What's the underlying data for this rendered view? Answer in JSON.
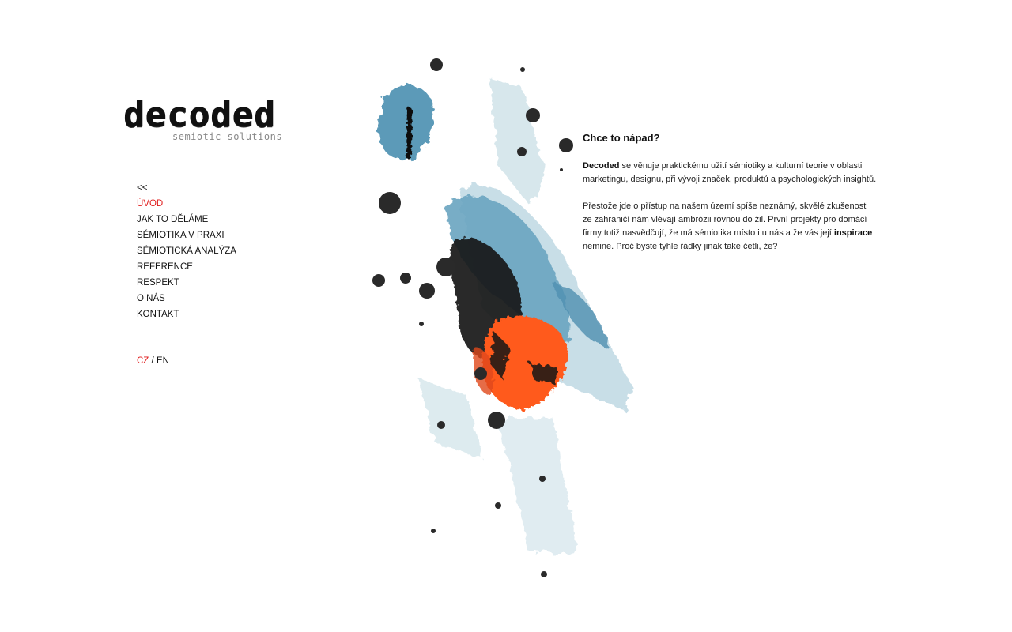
{
  "logo": {
    "main": "decoded",
    "sub": "semiotic solutions"
  },
  "nav": {
    "back": "<<",
    "items": [
      {
        "label": "ÚVOD",
        "active": true
      },
      {
        "label": "JAK TO DĚLÁME",
        "active": false
      },
      {
        "label": "SÉMIOTIKA V PRAXI",
        "active": false
      },
      {
        "label": "SÉMIOTICKÁ ANALÝZA",
        "active": false
      },
      {
        "label": "REFERENCE",
        "active": false
      },
      {
        "label": "RESPEKT",
        "active": false
      },
      {
        "label": "O NÁS",
        "active": false
      },
      {
        "label": "KONTAKT",
        "active": false
      }
    ]
  },
  "lang": {
    "cz": "CZ",
    "sep": "/",
    "en": "EN"
  },
  "content": {
    "heading": "Chce to nápad?",
    "p1_bold": "Decoded",
    "p1_rest": " se věnuje praktickému užití sémiotiky a kulturní teorie v oblasti marketingu, designu, při vývoji značek, produktů a psychologických insightů.",
    "p2_start": "Přestože jde o přístup na našem území spíše neznámý, skvělé zkušenosti ze zahraničí nám vlévají ambrózii rovnou do žil. První projekty pro domácí firmy totiž nasvědčují, že má sémiotika místo i u nás a že vás její ",
    "p2_bold": "inspirace",
    "p2_end": " nemine. Proč byste tyhle řádky jinak také četli, že?"
  },
  "colors": {
    "accent": "#e01b1b",
    "paint_blue": "#5c9ab8",
    "paint_orange": "#ff5a1a",
    "paint_black": "#1a1a1a"
  }
}
